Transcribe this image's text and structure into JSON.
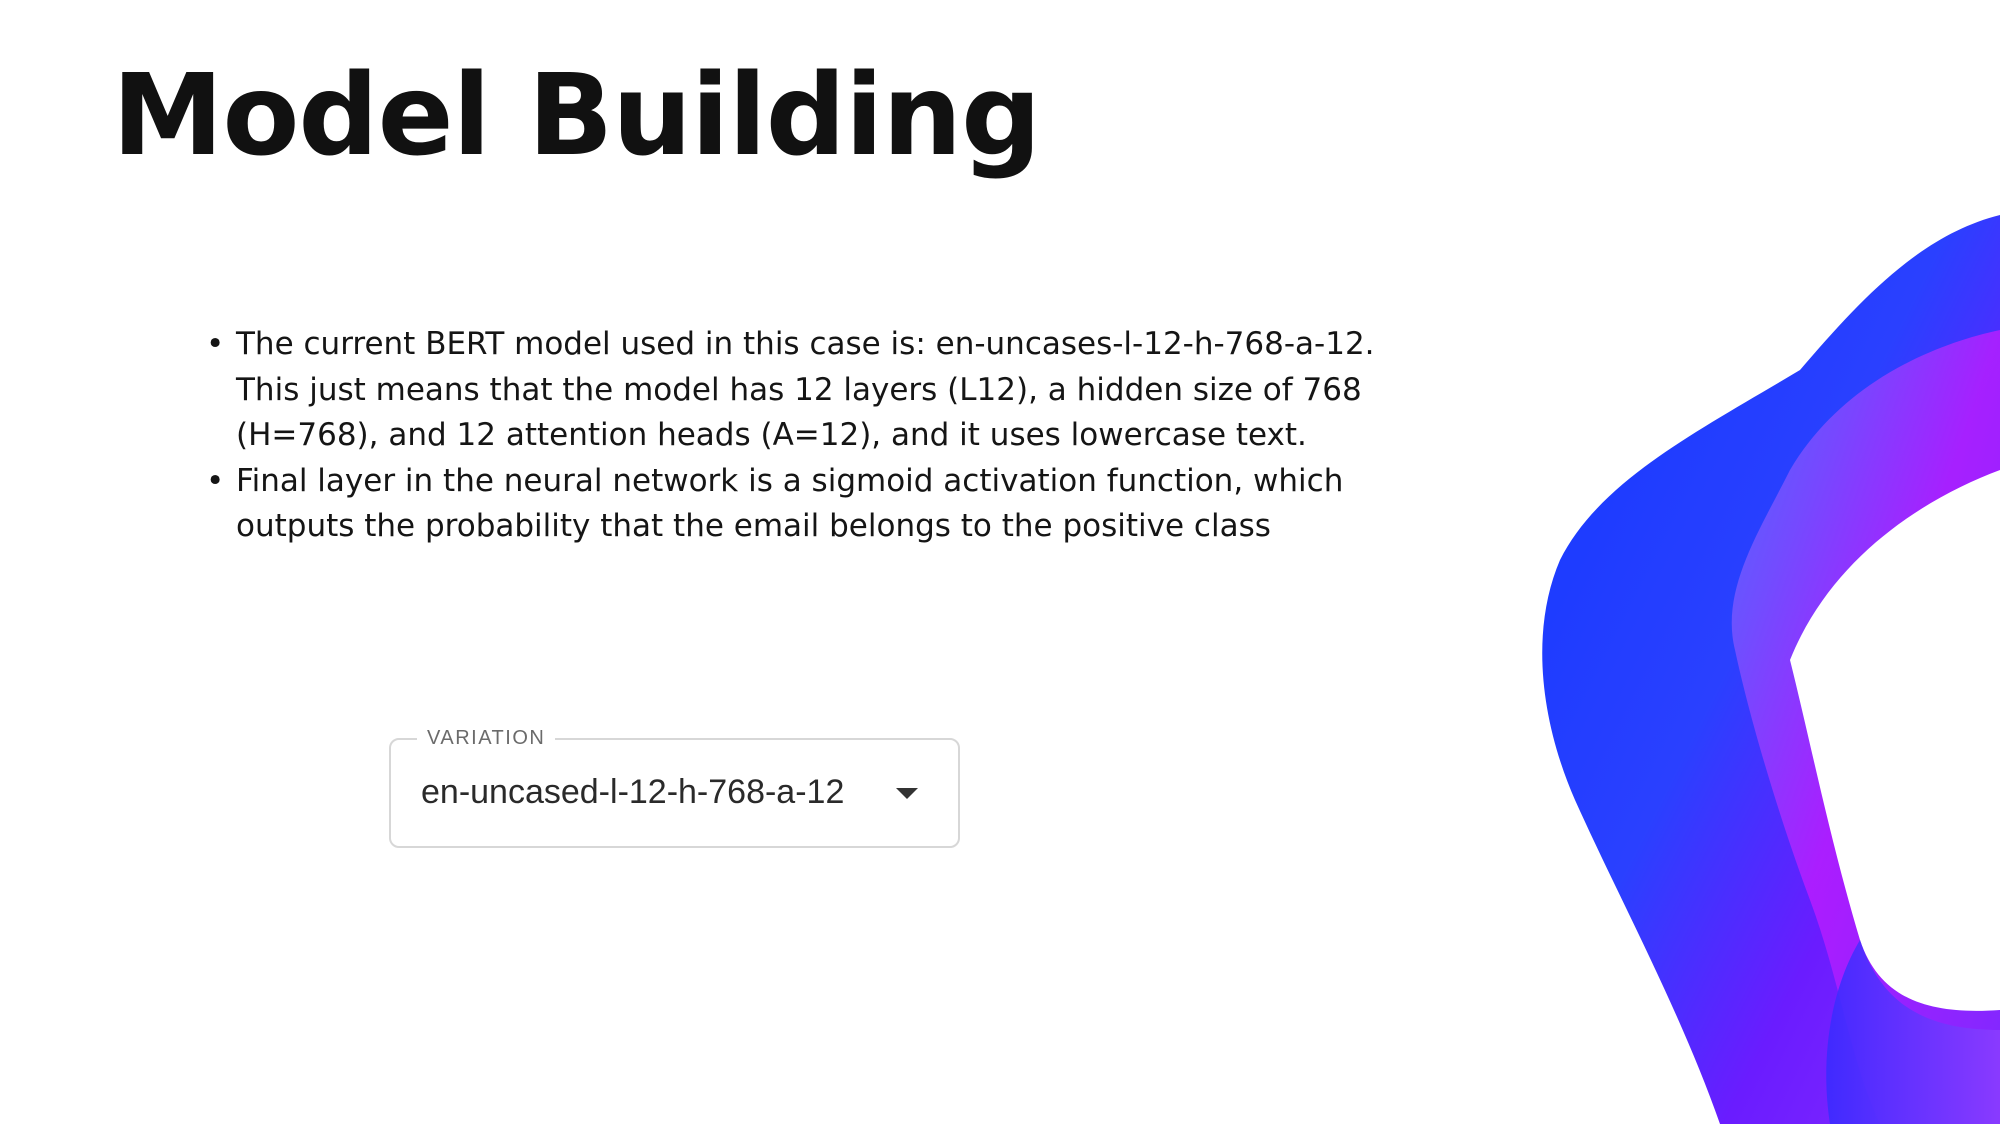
{
  "title": "Model Building",
  "bullets": [
    "The current BERT model used in this case is: en-uncases-l-12-h-768-a-12. This just means that the model has 12 layers (L12), a hidden size of 768 (H=768), and 12 attention heads (A=12), and it uses lowercase text.",
    "Final layer in the neural network is a sigmoid activation function, which outputs the probability that the email belongs to the positive class"
  ],
  "bullet_glyph": "•",
  "variation_select": {
    "label": "VARIATION",
    "value": "en-uncased-l-12-h-768-a-12",
    "caret_icon": "chevron-down-icon"
  },
  "colors": {
    "ribbon_blue": "#1a3cff",
    "ribbon_violet": "#6a1cff",
    "ribbon_magenta": "#d21cff"
  }
}
